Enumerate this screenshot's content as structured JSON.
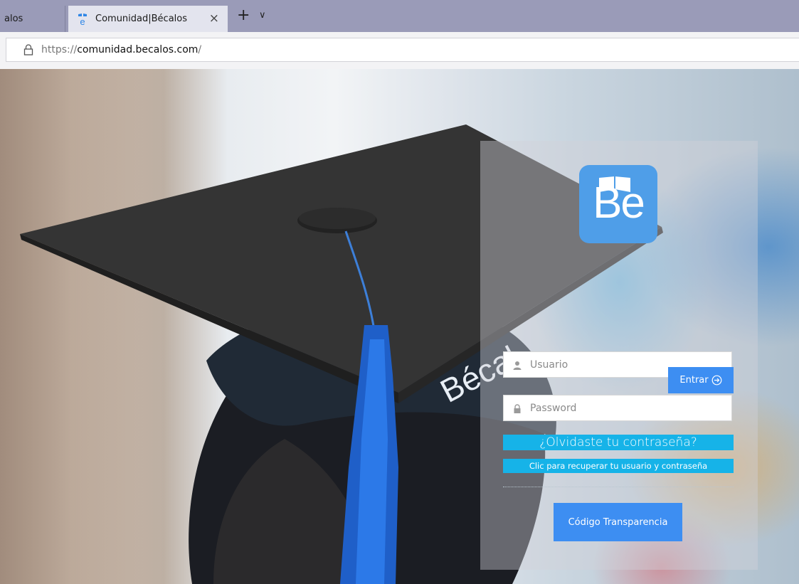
{
  "browser": {
    "tabs": [
      {
        "label": "alos",
        "active": false
      },
      {
        "label": "Comunidad|Bécalos",
        "active": true
      }
    ],
    "close_tab_symbol": "×",
    "new_tab_symbol": "+",
    "tab_list_symbol": "∨",
    "url_scheme": "https://",
    "url_domain": "comunidad.becalos.com",
    "url_path": "/"
  },
  "login": {
    "logo_text": "Be",
    "cap_text": "Bécal",
    "username_placeholder": "Usuario",
    "password_placeholder": "Password",
    "submit_label": "Entrar",
    "forgot_title": "¿Olvidaste tu contraseña?",
    "recover_link": "Clic para recuperar tu usuario y contraseña",
    "transparency_button": "Código Transparencia"
  },
  "colors": {
    "accent_blue": "#3d8ef2",
    "cyan_banner": "#16b3e8",
    "logo_blue": "#4f9ee8",
    "tab_bar": "#9a9bb8"
  }
}
